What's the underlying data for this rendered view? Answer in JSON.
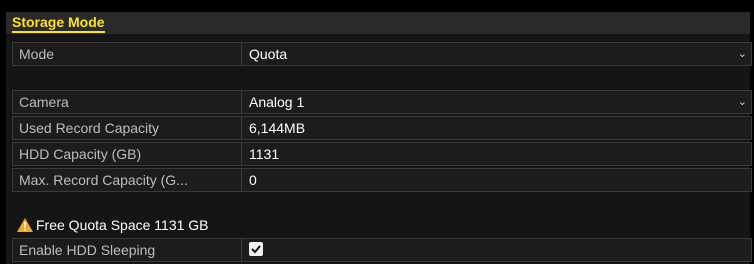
{
  "title": "Storage Mode",
  "mode": {
    "label": "Mode",
    "value": "Quota"
  },
  "camera": {
    "label": "Camera",
    "value": "Analog 1"
  },
  "used_record_capacity": {
    "label": "Used Record Capacity",
    "value": "6,144MB"
  },
  "hdd_capacity": {
    "label": "HDD Capacity (GB)",
    "value": "1131"
  },
  "max_record_capacity": {
    "label": "Max. Record Capacity (G...",
    "value": "0"
  },
  "free_quota": {
    "text": "Free Quota Space 1131 GB",
    "icon": "warning-icon"
  },
  "enable_hdd_sleeping": {
    "label": "Enable HDD Sleeping",
    "checked": true
  },
  "colors": {
    "accent": "#ffe21a",
    "background": "#151515",
    "warning": "#f5a623"
  }
}
